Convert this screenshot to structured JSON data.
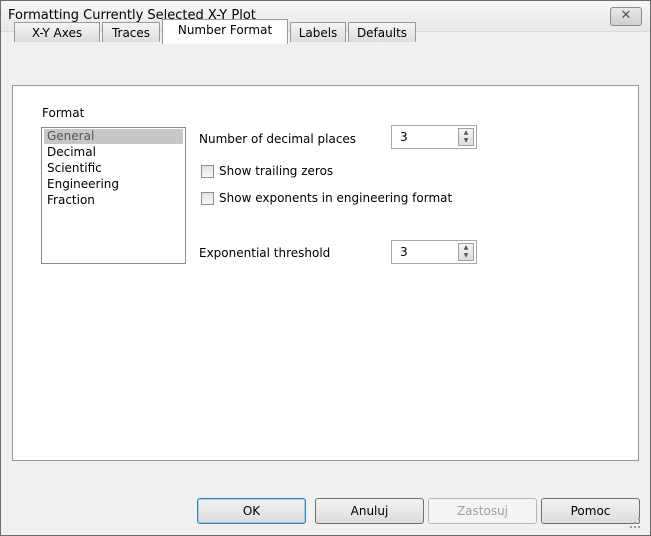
{
  "window": {
    "title": "Formatting Currently Selected X-Y Plot",
    "close_icon": "close-icon"
  },
  "tabs": [
    {
      "label": "X-Y Axes",
      "active": false
    },
    {
      "label": "Traces",
      "active": false
    },
    {
      "label": "Number Format",
      "active": true
    },
    {
      "label": "Labels",
      "active": false
    },
    {
      "label": "Defaults",
      "active": false
    }
  ],
  "format": {
    "group_label": "Format",
    "items": [
      "General",
      "Decimal",
      "Scientific",
      "Engineering",
      "Fraction"
    ],
    "selected": "General"
  },
  "decimal_places": {
    "label": "Number of decimal places",
    "value": "3"
  },
  "show_trailing_zeros": {
    "label": "Show trailing zeros",
    "checked": false
  },
  "show_exponents": {
    "label": "Show exponents in engineering format",
    "checked": false
  },
  "exponential_threshold": {
    "label": "Exponential threshold",
    "value": "3"
  },
  "buttons": {
    "ok": "OK",
    "cancel": "Anuluj",
    "apply": "Zastosuj",
    "help": "Pomoc"
  }
}
